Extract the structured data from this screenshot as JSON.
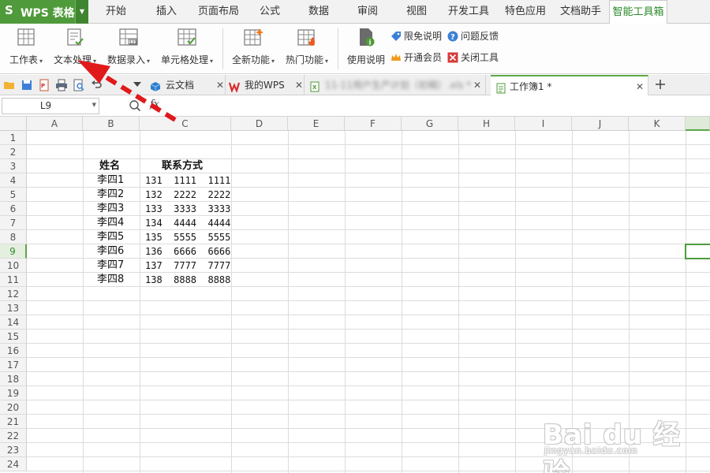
{
  "app": {
    "logo": "S",
    "title": "WPS 表格"
  },
  "menu_tabs": [
    "开始",
    "插入",
    "页面布局",
    "公式",
    "数据",
    "审阅",
    "视图",
    "开发工具",
    "特色应用",
    "文档助手",
    "智能工具箱"
  ],
  "active_menu_tab": "智能工具箱",
  "ribbon": {
    "big_buttons": [
      {
        "label": "工作表",
        "icon": "worksheet-icon"
      },
      {
        "label": "文本处理",
        "icon": "text-process-icon"
      },
      {
        "label": "数据录入",
        "icon": "data-entry-icon"
      },
      {
        "label": "单元格处理",
        "icon": "cell-process-icon"
      },
      {
        "label": "全新功能",
        "icon": "new-features-icon"
      },
      {
        "label": "热门功能",
        "icon": "hot-features-icon"
      },
      {
        "label": "使用说明",
        "icon": "help-doc-icon"
      }
    ],
    "small_buttons": [
      {
        "label": "限免说明",
        "icon": "tag-icon"
      },
      {
        "label": "问题反馈",
        "icon": "question-icon"
      },
      {
        "label": "开通会员",
        "icon": "crown-icon"
      },
      {
        "label": "关闭工具",
        "icon": "close-box-icon"
      }
    ]
  },
  "doc_tabs": [
    {
      "label": "云文档",
      "icon": "cloud-box-icon",
      "closable": true
    },
    {
      "label": "我的WPS",
      "icon": "wps-logo-icon",
      "closable": true
    },
    {
      "label": "11-11用户生产计划（初稿）.xls *",
      "icon": "xls-file-icon",
      "closable": true,
      "blurred": true
    },
    {
      "label": "工作簿1 *",
      "icon": "sheet-file-icon",
      "closable": true,
      "active": true
    }
  ],
  "formula_bar": {
    "name_box": "L9",
    "fx_label": "fx",
    "formula": ""
  },
  "sheet": {
    "columns": [
      "A",
      "B",
      "C",
      "D",
      "E",
      "F",
      "G",
      "H",
      "I",
      "J",
      "K"
    ],
    "rows": [
      "1",
      "2",
      "3",
      "4",
      "5",
      "6",
      "7",
      "8",
      "9",
      "10",
      "11",
      "12",
      "13",
      "14",
      "15",
      "16",
      "17",
      "18",
      "19",
      "20",
      "21",
      "22",
      "23",
      "24"
    ],
    "selected_row": "9",
    "headers": {
      "name": "姓名",
      "contact": "联系方式"
    },
    "records": [
      {
        "name": "李四1",
        "phone": "131  1111  1111"
      },
      {
        "name": "李四2",
        "phone": "132  2222  2222"
      },
      {
        "name": "李四3",
        "phone": "133  3333  3333"
      },
      {
        "name": "李四4",
        "phone": "134  4444  4444"
      },
      {
        "name": "李四5",
        "phone": "135  5555  5555"
      },
      {
        "name": "李四6",
        "phone": "136  6666  6666"
      },
      {
        "name": "李四7",
        "phone": "137  7777  7777"
      },
      {
        "name": "李四8",
        "phone": "138  8888  8888"
      }
    ]
  },
  "annotation": {
    "color": "#e0191b"
  },
  "watermark": {
    "brand": "Bai du 经验",
    "url": "jingyan.baidu.com"
  },
  "colors": {
    "accent": "#4f9a3a",
    "active_tab_text": "#2a8a2a"
  }
}
